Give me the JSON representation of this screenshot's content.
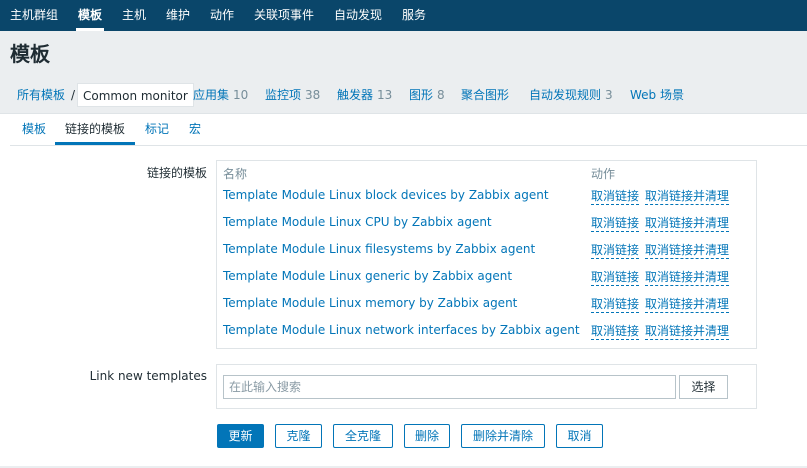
{
  "topnav": {
    "items": [
      "主机群组",
      "模板",
      "主机",
      "维护",
      "动作",
      "关联项事件",
      "自动发现",
      "服务"
    ],
    "active": "模板"
  },
  "page": {
    "title": "模板"
  },
  "breadcrumb": {
    "all_templates": "所有模板",
    "separator": "/",
    "current": "Common monitor",
    "links": [
      {
        "label": "应用集",
        "count": "10"
      },
      {
        "label": "监控项",
        "count": "38"
      },
      {
        "label": "触发器",
        "count": "13"
      },
      {
        "label": "图形",
        "count": "8"
      },
      {
        "label": "聚合图形",
        "count": ""
      },
      {
        "label": "自动发现规则",
        "count": "3"
      },
      {
        "label": "Web 场景",
        "count": ""
      }
    ]
  },
  "tabs": [
    "模板",
    "链接的模板",
    "标记",
    "宏"
  ],
  "active_tab": "链接的模板",
  "linked": {
    "label": "链接的模板",
    "col_name": "名称",
    "col_action": "动作",
    "unlink_label": "取消链接",
    "unlink_clear_label": "取消链接并清理",
    "rows": [
      "Template Module Linux block devices by Zabbix agent",
      "Template Module Linux CPU by Zabbix agent",
      "Template Module Linux filesystems by Zabbix agent",
      "Template Module Linux generic by Zabbix agent",
      "Template Module Linux memory by Zabbix agent",
      "Template Module Linux network interfaces by Zabbix agent"
    ]
  },
  "link_new": {
    "label": "Link new templates",
    "placeholder": "在此输入搜索",
    "value": "",
    "select_label": "选择"
  },
  "buttons": {
    "update": "更新",
    "clone": "克隆",
    "full_clone": "全克隆",
    "delete": "删除",
    "delete_clear": "删除并清除",
    "cancel": "取消"
  },
  "colors": {
    "header_bg": "#0a466a",
    "link": "#0275b8",
    "primary_button": "#0275b8",
    "page_bg": "#ebeef0",
    "muted": "#768d99"
  }
}
